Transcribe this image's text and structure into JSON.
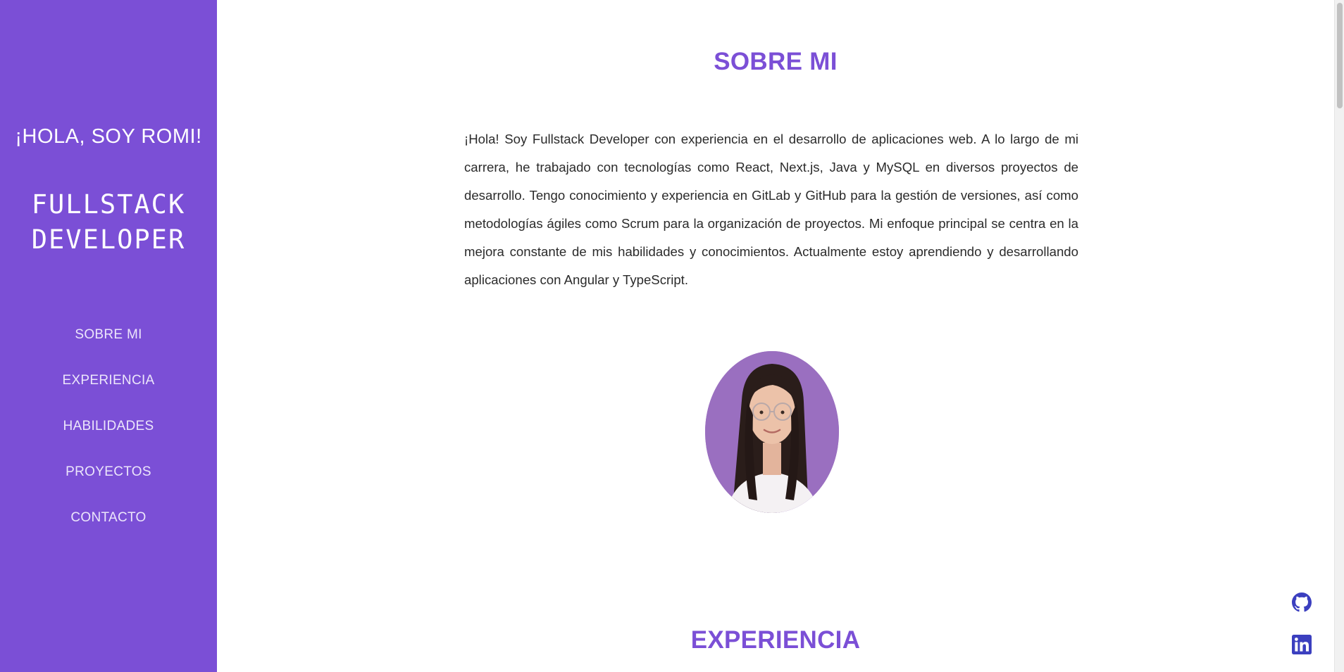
{
  "sidebar": {
    "greeting": "¡HOLA, SOY ROMI!",
    "role_line1": "FULLSTACK",
    "role_line2": "DEVELOPER",
    "nav": [
      {
        "label": "SOBRE MI"
      },
      {
        "label": "EXPERIENCIA"
      },
      {
        "label": "HABILIDADES"
      },
      {
        "label": "PROYECTOS"
      },
      {
        "label": "CONTACTO"
      }
    ]
  },
  "about": {
    "title": "SOBRE MI",
    "text": "¡Hola! Soy Fullstack Developer con experiencia en el desarrollo de aplicaciones web. A lo largo de mi carrera, he trabajado con tecnologías como React, Next.js, Java y MySQL en diversos proyectos de desarrollo. Tengo conocimiento y experiencia en GitLab y GitHub para la gestión de versiones, así como metodologías ágiles como Scrum para la organización de proyectos. Mi enfoque principal se centra en la mejora constante de mis habilidades y conocimientos. Actualmente estoy aprendiendo y desarrollando aplicaciones con Angular y TypeScript."
  },
  "experience": {
    "title": "EXPERIENCIA"
  },
  "social": {
    "github_icon": "github-icon",
    "linkedin_icon": "linkedin-icon"
  },
  "colors": {
    "accent": "#7b4fd6",
    "social": "#3b3fbf"
  }
}
